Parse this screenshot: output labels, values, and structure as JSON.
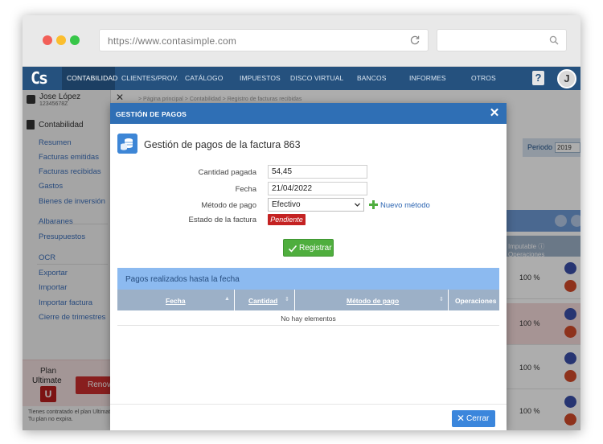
{
  "browser": {
    "url": "https://www.contasimple.com"
  },
  "nav": {
    "logo": "Cs",
    "items": [
      "CONTABILIDAD",
      "CLIENTES/PROV.",
      "CATÁLOGO",
      "IMPUESTOS",
      "DISCO VIRTUAL",
      "BANCOS",
      "INFORMES",
      "OTROS"
    ],
    "help": "?",
    "avatar": "J"
  },
  "sidebar": {
    "user_name": "Jose López",
    "user_id": "12345678Z",
    "section": "Contabilidad",
    "links": [
      "Resumen",
      "Facturas emitidas",
      "Facturas recibidas",
      "Gastos",
      "Bienes de inversión",
      "Albaranes",
      "Presupuestos",
      "OCR",
      "Exportar",
      "Importar",
      "Importar factura",
      "Cierre de trimestres"
    ],
    "plan_label": "Plan",
    "plan_name": "Ultimate",
    "plan_badge": "U",
    "renew": "Renovar",
    "plan_info": [
      "Tienes contratado el plan Ultimate.",
      "Tu plan no expira."
    ]
  },
  "main": {
    "breadcrumb": "> Página principal > Contabilidad > Registro de facturas recibidas",
    "periodo_label": "Periodo",
    "periodo_value": "2019",
    "imputable": "Imputable",
    "operations": "Operaciones",
    "percentages": [
      "100 %",
      "100 %",
      "100 %",
      "100 %"
    ]
  },
  "modal": {
    "title": "GESTIÓN DE PAGOS",
    "heading": "Gestión de pagos de la factura 863",
    "amount_label": "Cantidad pagada",
    "amount_value": "54,45",
    "date_label": "Fecha",
    "date_value": "21/04/2022",
    "method_label": "Método de pago",
    "method_value": "Efectivo",
    "new_method": "Nuevo método",
    "status_label": "Estado de la factura",
    "status_value": "Pendiente",
    "register": "Registrar",
    "payments_title": "Pagos realizados hasta la fecha",
    "columns": [
      "Fecha",
      "Cantidad",
      "Método de pago",
      "Operaciones"
    ],
    "empty": "No hay elementos",
    "close": "Cerrar"
  },
  "colors": {
    "nav_bg": "#25517e",
    "modal_header": "#2f6fb5",
    "status_red": "#c42222",
    "register_green": "#4fae3e",
    "close_blue": "#3b86dc"
  }
}
